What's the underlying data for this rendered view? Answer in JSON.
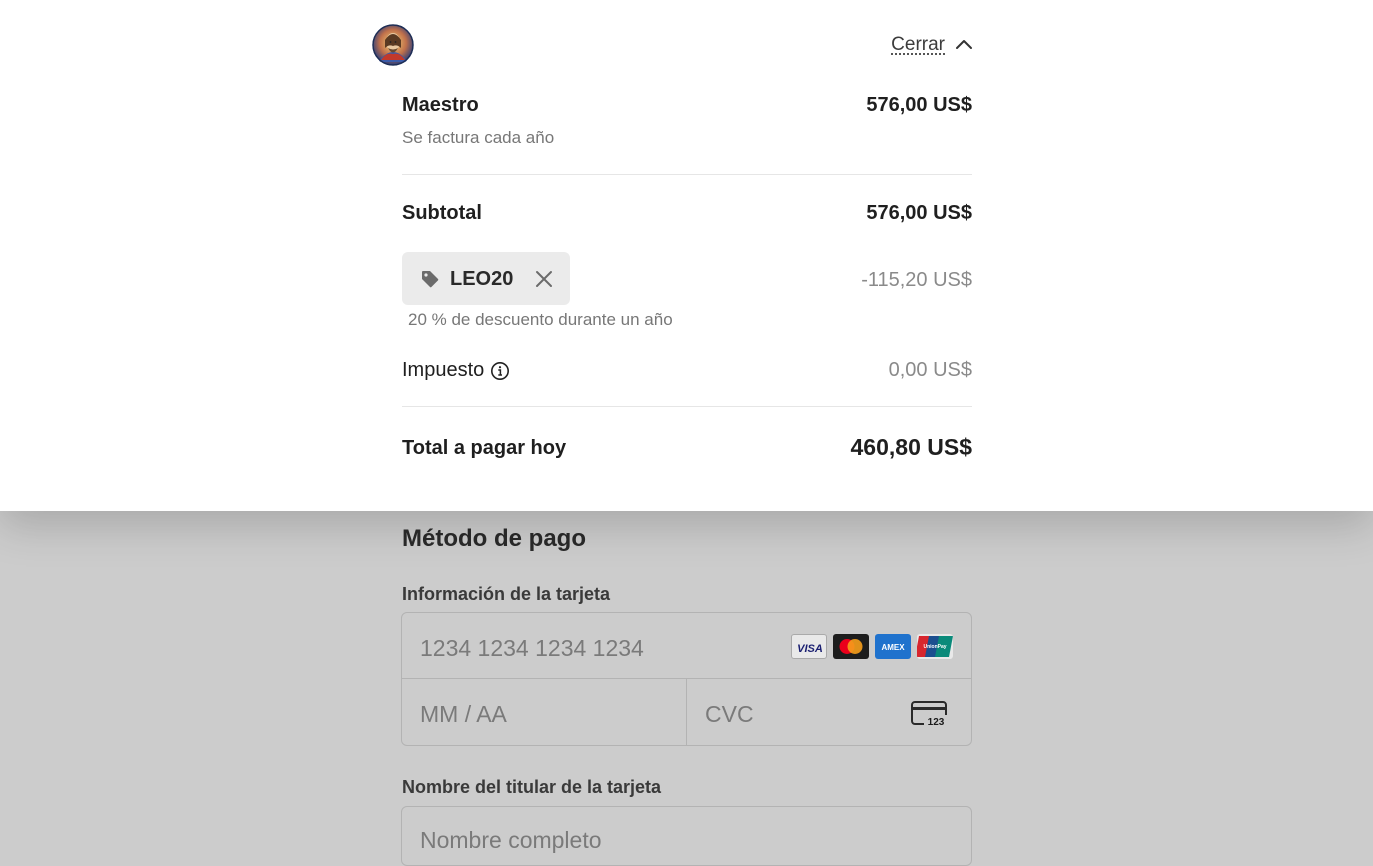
{
  "header": {
    "close_label": "Cerrar"
  },
  "summary": {
    "item": {
      "name": "Maestro",
      "price": "576,00 US$",
      "billing": "Se factura cada año"
    },
    "subtotal": {
      "label": "Subtotal",
      "amount": "576,00 US$"
    },
    "promo": {
      "code": "LEO20",
      "amount": "-115,20 US$",
      "description": "20 % de descuento durante un año"
    },
    "tax": {
      "label": "Impuesto",
      "amount": "0,00 US$"
    },
    "total": {
      "label": "Total a pagar hoy",
      "amount": "460,80 US$"
    }
  },
  "payment": {
    "title": "Método de pago",
    "card_label": "Información de la tarjeta",
    "card_number_placeholder": "1234 1234 1234 1234",
    "expiry_placeholder": "MM / AA",
    "cvc_placeholder": "CVC",
    "cvc_icon_text": "123",
    "brands": [
      "VISA",
      "mastercard",
      "AMEX",
      "UnionPay"
    ],
    "name_label": "Nombre del titular de la tarjeta",
    "name_placeholder": "Nombre completo"
  }
}
